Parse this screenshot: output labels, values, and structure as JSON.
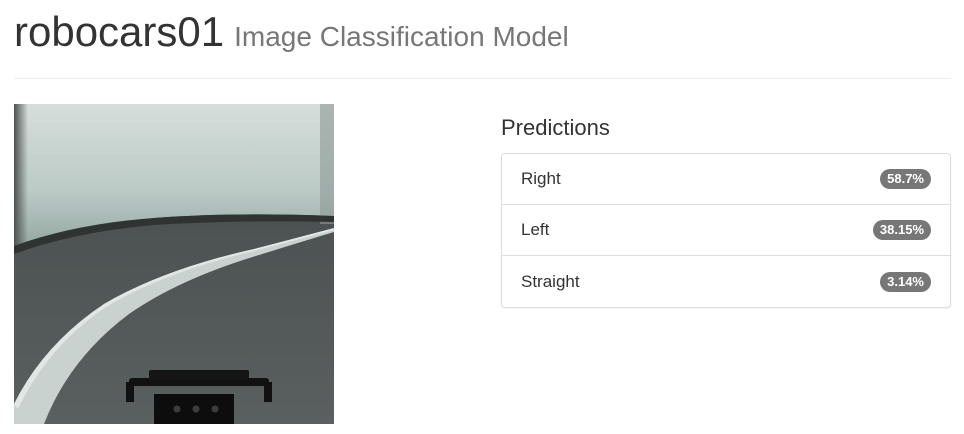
{
  "header": {
    "title": "robocars01",
    "subtitle": "Image Classification Model"
  },
  "camera": {
    "icon": "camera-feed-image"
  },
  "predictions": {
    "title": "Predictions",
    "items": [
      {
        "label": "Right",
        "value": "58.7%"
      },
      {
        "label": "Left",
        "value": "38.15%"
      },
      {
        "label": "Straight",
        "value": "3.14%"
      }
    ]
  },
  "colors": {
    "badge": "#777777",
    "title": "#333333",
    "subtitle": "#777777"
  }
}
